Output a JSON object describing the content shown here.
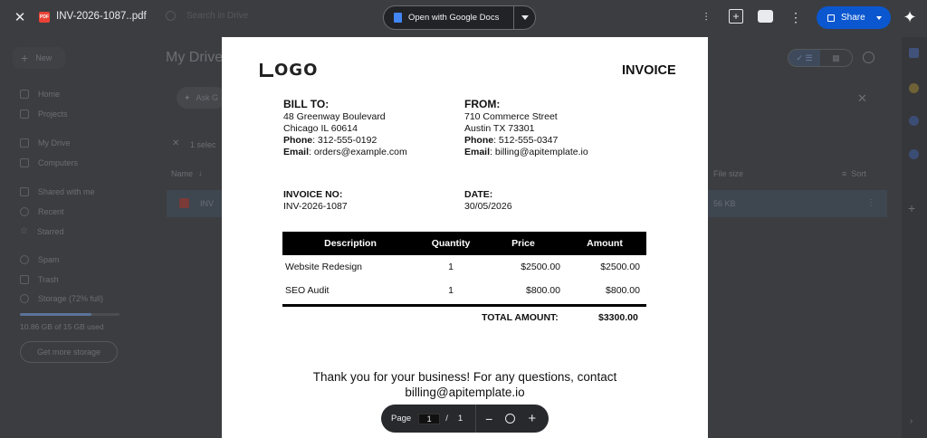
{
  "topbar": {
    "filename": "INV-2026-1087..pdf",
    "file_badge": "PDF",
    "open_with": "Open with Google Docs",
    "share": "Share"
  },
  "background": {
    "search_placeholder": "Search in Drive",
    "new": "New",
    "page_title": "My Drive",
    "ask": "Ask G",
    "nav": [
      "Home",
      "Projects",
      "My Drive",
      "Computers",
      "Shared with me",
      "Recent",
      "Starred",
      "Spam",
      "Trash",
      "Storage (72% full)"
    ],
    "storage_text": "10.86 GB of 15 GB used",
    "get_storage": "Get more storage",
    "selected": "1 selec",
    "col_name": "Name",
    "col_size": "File size",
    "sort": "Sort",
    "row_name": "INV",
    "row_size": "56 KB"
  },
  "invoice": {
    "logo": "OGO",
    "title": "INVOICE",
    "bill_to": {
      "heading": "BILL TO:",
      "line1": "48 Greenway Boulevard",
      "line2": "Chicago IL 60614",
      "phone_label": "Phone",
      "phone": ": 312-555-0192",
      "email_label": "Email",
      "email": ": orders@example.com"
    },
    "from": {
      "heading": "FROM:",
      "line1": "710 Commerce Street",
      "line2": "Austin TX 73301",
      "phone_label": "Phone",
      "phone": ": 512-555-0347",
      "email_label": "Email",
      "email": ": billing@apitemplate.io"
    },
    "invoice_no_label": "INVOICE NO:",
    "invoice_no": "INV-2026-1087",
    "date_label": "DATE:",
    "date": "30/05/2026",
    "columns": [
      "Description",
      "Quantity",
      "Price",
      "Amount"
    ],
    "items": [
      {
        "description": "Website Redesign",
        "quantity": "1",
        "price": "$2500.00",
        "amount": "$2500.00"
      },
      {
        "description": "SEO Audit",
        "quantity": "1",
        "price": "$800.00",
        "amount": "$800.00"
      }
    ],
    "total_label": "TOTAL AMOUNT:",
    "total": "$3300.00",
    "thanks_line1": "Thank you for your business! For any questions, contact",
    "thanks_line2": "billing@apitemplate.io"
  },
  "pager": {
    "label": "Page",
    "current": "1",
    "separator": "/",
    "total": "1"
  },
  "colors": {
    "share_bg": "#0b57d0",
    "overlay_bg": "#3f4044",
    "pdf_badge": "#ea4335"
  }
}
